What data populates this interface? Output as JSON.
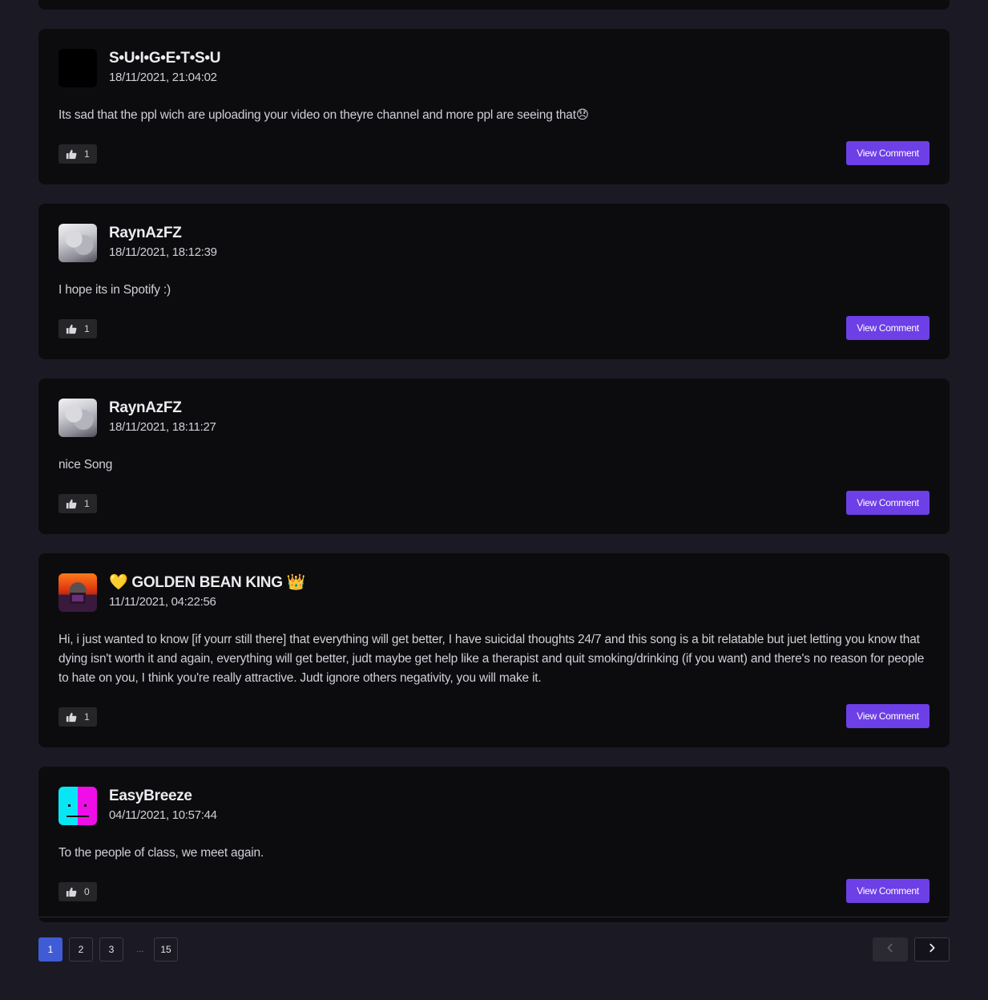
{
  "comments": [
    {
      "username": "S•U•I•G•E•T•S•U",
      "timestamp": "18/11/2021, 21:04:02",
      "text": "Its sad that the ppl wich are uploading your video on theyre channel and more ppl are seeing that😞",
      "likes": "1",
      "view_label": "View Comment",
      "avatar": "black"
    },
    {
      "username": "RaynAzFZ",
      "timestamp": "18/11/2021, 18:12:39",
      "text": "I hope its in Spotify :)",
      "likes": "1",
      "view_label": "View Comment",
      "avatar": "anime"
    },
    {
      "username": "RaynAzFZ",
      "timestamp": "18/11/2021, 18:11:27",
      "text": "nice Song",
      "likes": "1",
      "view_label": "View Comment",
      "avatar": "anime"
    },
    {
      "username": "💛 GOLDEN BEAN KING 👑",
      "timestamp": "11/11/2021, 04:22:56",
      "text": "Hi, i just wanted to know [if yourr still there] that everything will get better, I have suicidal thoughts 24/7 and this song is a bit relatable but juet letting you know that dying isn't worth it and again, everything will get better, judt maybe get help like a therapist and quit smoking/drinking (if you want) and there's no reason for people to hate on you, I think you're really attractive. Judt ignore others negativity, you will make it.",
      "likes": "1",
      "view_label": "View Comment",
      "avatar": "fire"
    },
    {
      "username": "EasyBreeze",
      "timestamp": "04/11/2021, 10:57:44",
      "text": "To the people of class, we meet again.",
      "likes": "0",
      "view_label": "View Comment",
      "avatar": "cyan"
    }
  ],
  "pagination": {
    "pages": [
      "1",
      "2",
      "3"
    ],
    "ellipsis": "...",
    "last_page": "15",
    "current": "1"
  },
  "icons": {
    "like": "thumbs-up-icon",
    "prev": "chevron-left-icon",
    "next": "chevron-right-icon"
  },
  "colors": {
    "background": "#1b1a24",
    "card": "#0c0c0f",
    "accent": "#6d3fe6",
    "page_active": "#3f5bd6"
  }
}
